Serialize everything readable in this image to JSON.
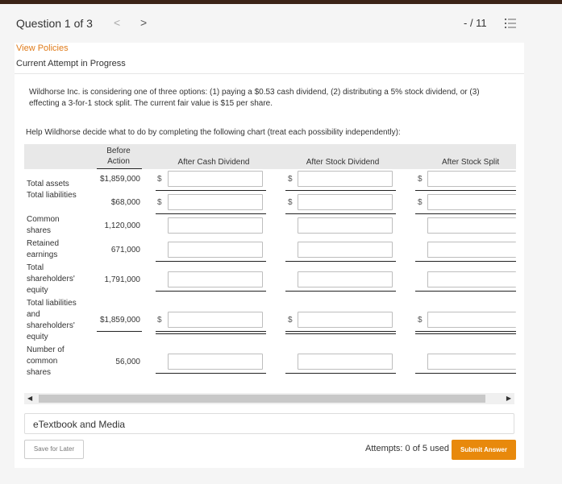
{
  "header": {
    "question_label": "Question 1 of 3",
    "prev_glyph": "<",
    "next_glyph": ">",
    "score": "- / 11"
  },
  "links": {
    "view_policies": "View Policies"
  },
  "attempt_status": "Current Attempt in Progress",
  "problem_text": "Wildhorse Inc. is considering one of three options: (1) paying a $0.53 cash dividend, (2) distributing a 5% stock dividend, or (3) effecting a 3-for-1 stock split. The current fair value is $15 per share.",
  "help_text": "Help Wildhorse decide what to do by completing the following chart (treat each possibility independently):",
  "table": {
    "headers": {
      "before_line1": "Before",
      "before_line2": "Action",
      "cash": "After Cash Dividend",
      "stock": "After Stock Dividend",
      "split": "After Stock Split"
    },
    "currency_symbol": "$",
    "rows": [
      {
        "label": "Total assets",
        "value": "$1,859,000"
      },
      {
        "label": "Total liabilities",
        "value": "$68,000"
      },
      {
        "label": "Common shares",
        "value": "1,120,000"
      },
      {
        "label": "Retained earnings",
        "value": "671,000"
      },
      {
        "label": "Total shareholders' equity",
        "value": "1,791,000"
      },
      {
        "label": "Total liabilities and shareholders' equity",
        "value": "$1,859,000"
      },
      {
        "label": "Number of common shares",
        "value": "56,000"
      }
    ]
  },
  "etextbook_label": "eTextbook and Media",
  "footer": {
    "save_label": "Save for Later",
    "attempts_text": "Attempts: 0 of 5 used",
    "submit_label": "Submit Answer"
  },
  "colors": {
    "accent": "#e8890c",
    "link": "#e07b1a",
    "topbar": "#3b2317"
  }
}
